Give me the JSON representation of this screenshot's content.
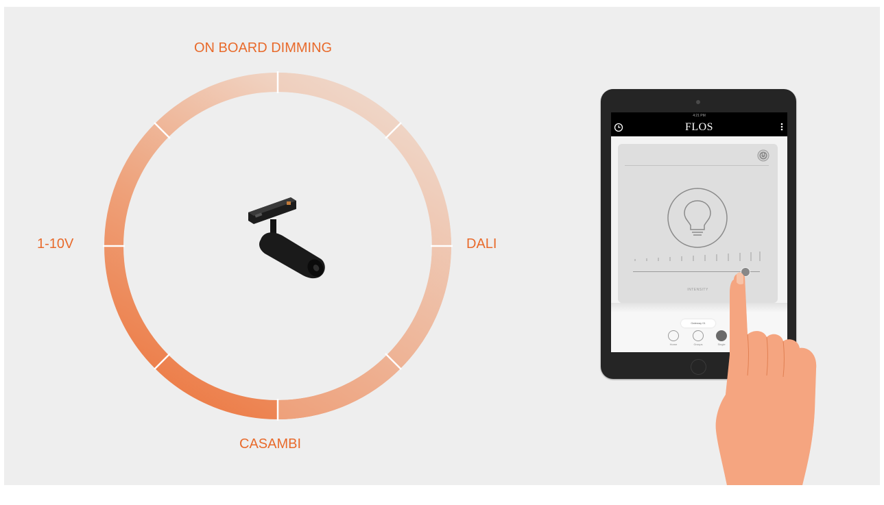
{
  "diagram": {
    "ring_labels": {
      "top": "ON BOARD DIMMING",
      "left": "1-10V",
      "right": "DALI",
      "bottom": "CASAMBI"
    },
    "accent_color": "#e86a2b",
    "center_image": "track-spotlight"
  },
  "tablet": {
    "status_time": "4:21 PM",
    "brand": "FLOS",
    "intensity_label": "INTENSITY",
    "intensity_level": 0.88,
    "gateway_label": "Gateway 01",
    "nav": [
      {
        "label": "Home",
        "icon": "home-icon"
      },
      {
        "label": "Groups",
        "icon": "groups-icon"
      },
      {
        "label": "Single",
        "icon": "bulb-icon"
      }
    ]
  }
}
